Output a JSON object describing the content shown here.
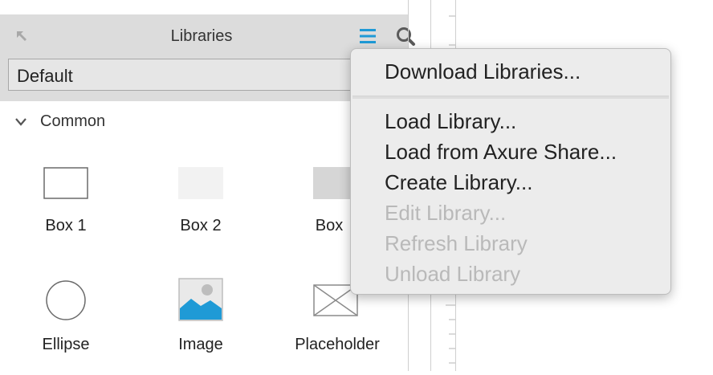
{
  "panel": {
    "title": "Libraries",
    "library_select": {
      "value": "Default"
    },
    "section": {
      "label": "Common"
    },
    "widgets": [
      {
        "label": "Box 1",
        "icon": "box1-icon"
      },
      {
        "label": "Box 2",
        "icon": "box2-icon"
      },
      {
        "label": "Box",
        "icon": "box3-icon"
      },
      {
        "label": "Ellipse",
        "icon": "ellipse-icon"
      },
      {
        "label": "Image",
        "icon": "image-icon"
      },
      {
        "label": "Placeholder",
        "icon": "placeholder-icon"
      }
    ]
  },
  "menu": {
    "items": [
      {
        "label": "Download Libraries...",
        "enabled": true
      },
      {
        "label": "Load Library...",
        "enabled": true
      },
      {
        "label": "Load from Axure Share...",
        "enabled": true
      },
      {
        "label": "Create Library...",
        "enabled": true
      },
      {
        "label": "Edit Library...",
        "enabled": false
      },
      {
        "label": "Refresh Library",
        "enabled": false
      },
      {
        "label": "Unload Library",
        "enabled": false
      }
    ]
  },
  "colors": {
    "accent": "#1f9ad6",
    "header_bg": "#dcdcdc",
    "menu_bg": "#ececec",
    "disabled_text": "#b9b9b9"
  }
}
